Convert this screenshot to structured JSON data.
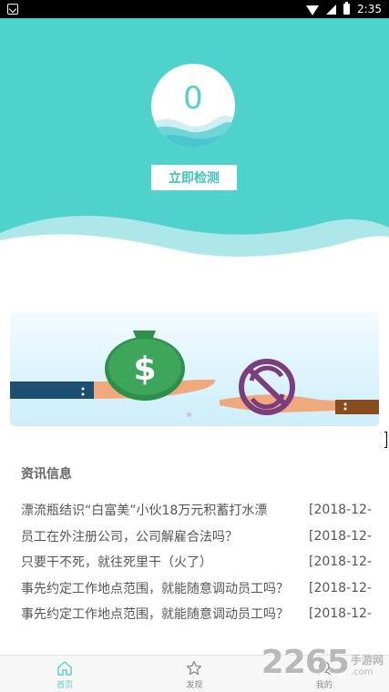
{
  "status_bar": {
    "time": "2:35"
  },
  "hero": {
    "gauge_value": "0",
    "detect_button_label": "立即检测",
    "colors": {
      "teal": "#4fd1cc",
      "light_wave": "#aee7ea"
    }
  },
  "banner": {
    "icons": [
      "money-bag-icon",
      "hand-icon",
      "no-refund-icon"
    ],
    "dots": 1
  },
  "news": {
    "title": "资讯信息",
    "items": [
      {
        "text": "漂流瓶结识“白富美”小伙18万元积蓄打水漂",
        "date": "[2018-12-"
      },
      {
        "text": "员工在外注册公司，公司解雇合法吗？",
        "date": "[2018-12-"
      },
      {
        "text": "只要干不死，就往死里干（火了）",
        "date": "[2018-12-"
      },
      {
        "text": "事先约定工作地点范围，就能随意调动员工吗？",
        "date": "[2018-12-"
      },
      {
        "text": "事先约定工作地点范围，就能随意调动员工吗？",
        "date": "[2018-12-"
      }
    ]
  },
  "tabbar": {
    "tabs": [
      {
        "label": "首页",
        "icon": "home-icon",
        "active": true
      },
      {
        "label": "发现",
        "icon": "star-icon",
        "active": false
      },
      {
        "label": "我的",
        "icon": "user-icon",
        "active": false
      }
    ]
  },
  "watermark": {
    "number": "2265",
    "cn": "手游网",
    "en": ".com"
  }
}
